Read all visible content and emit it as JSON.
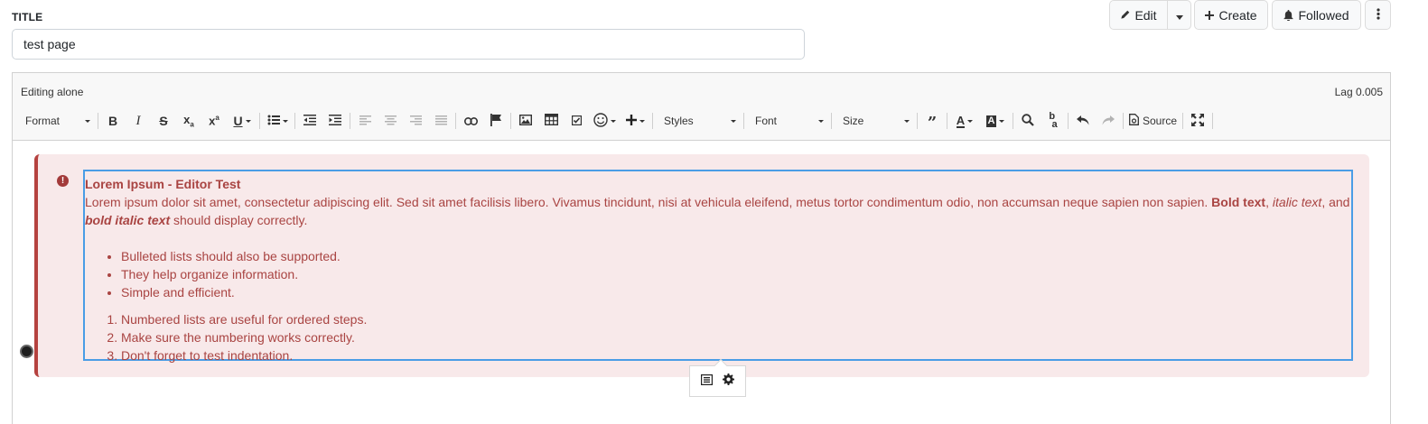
{
  "title_section": {
    "label": "TITLE",
    "value": "test page"
  },
  "actions": {
    "edit_label": "Edit",
    "create_label": "Create",
    "followed_label": "Followed"
  },
  "editor": {
    "status": "Editing alone",
    "lag": "Lag 0.005",
    "toolbar": {
      "format": "Format",
      "styles": "Styles",
      "font": "Font",
      "size": "Size",
      "source": "Source"
    },
    "alert": {
      "title": "Lorem Ipsum - Editor Test",
      "paragraph_start": "Lorem ipsum dolor sit amet, consectetur adipiscing elit. Sed sit amet facilisis libero. Vivamus tincidunt, nisi at vehicula eleifend, metus tortor condimentum odio, non accumsan neque sapien non sapien. ",
      "bold": "Bold text",
      "comma": ", ",
      "italic": "italic text",
      "and": ", and ",
      "bold_italic": "bold italic text",
      "end": " should display correctly.",
      "bullets": [
        "Bulleted lists should also be supported.",
        "They help organize information.",
        "Simple and efficient."
      ],
      "numbered": [
        "Numbered lists are useful for ordered steps.",
        "Make sure the numbering works correctly.",
        "Don't forget to test indentation."
      ]
    }
  },
  "colors": {
    "alert_text": "#a94442",
    "alert_bg": "#f8e9ea",
    "alert_border": "#b5423f",
    "selection_border": "#4a9de6"
  }
}
